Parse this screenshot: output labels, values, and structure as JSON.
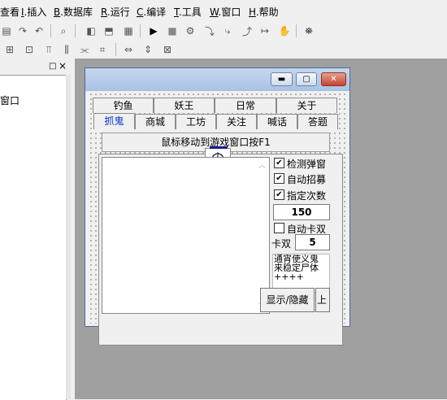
{
  "menubar": {
    "items": [
      {
        "prefix": "",
        "acc": "",
        "text": "查看"
      },
      {
        "prefix": "",
        "acc": "I",
        "text": ".插入"
      },
      {
        "prefix": "",
        "acc": "B",
        "text": ".数据库"
      },
      {
        "prefix": "",
        "acc": "R",
        "text": ".运行"
      },
      {
        "prefix": "",
        "acc": "C",
        "text": ".编译"
      },
      {
        "prefix": "",
        "acc": "T",
        "text": ".工具"
      },
      {
        "prefix": "",
        "acc": "W",
        "text": ".窗口"
      },
      {
        "prefix": "",
        "acc": "H",
        "text": ".帮助"
      }
    ]
  },
  "left_panel": {
    "pin_icon": "□",
    "close_icon": "×",
    "tree_item": "窗口"
  },
  "form": {
    "minimize_glyph": "▬",
    "maximize_glyph": "▢",
    "close_glyph": "✕",
    "tabs_row1": [
      "钓鱼",
      "妖王",
      "日常",
      "关于"
    ],
    "tabs_row2": [
      "抓鬼",
      "商城",
      "工坊",
      "关注",
      "喊话",
      "答题"
    ],
    "selected_tab": "抓鬼",
    "hint_button": "鼠标移动到游戏窗口按F1",
    "checkboxes": [
      {
        "label": "检测弹窗",
        "checked": true,
        "mark": "✔"
      },
      {
        "label": "自动招募",
        "checked": true,
        "mark": "✔"
      },
      {
        "label": "指定次数",
        "checked": true,
        "mark": "✔"
      },
      {
        "label": "自动卡双",
        "checked": false,
        "mark": ""
      }
    ],
    "count_value": "150",
    "kashuang_label": "卡双",
    "kashuang_value": "5",
    "notes_text": [
      "通宵使义鬼",
      "来稳定尸体",
      "++++"
    ],
    "show_hide_button": "显示/隐藏",
    "overlay_button_text": "上"
  }
}
